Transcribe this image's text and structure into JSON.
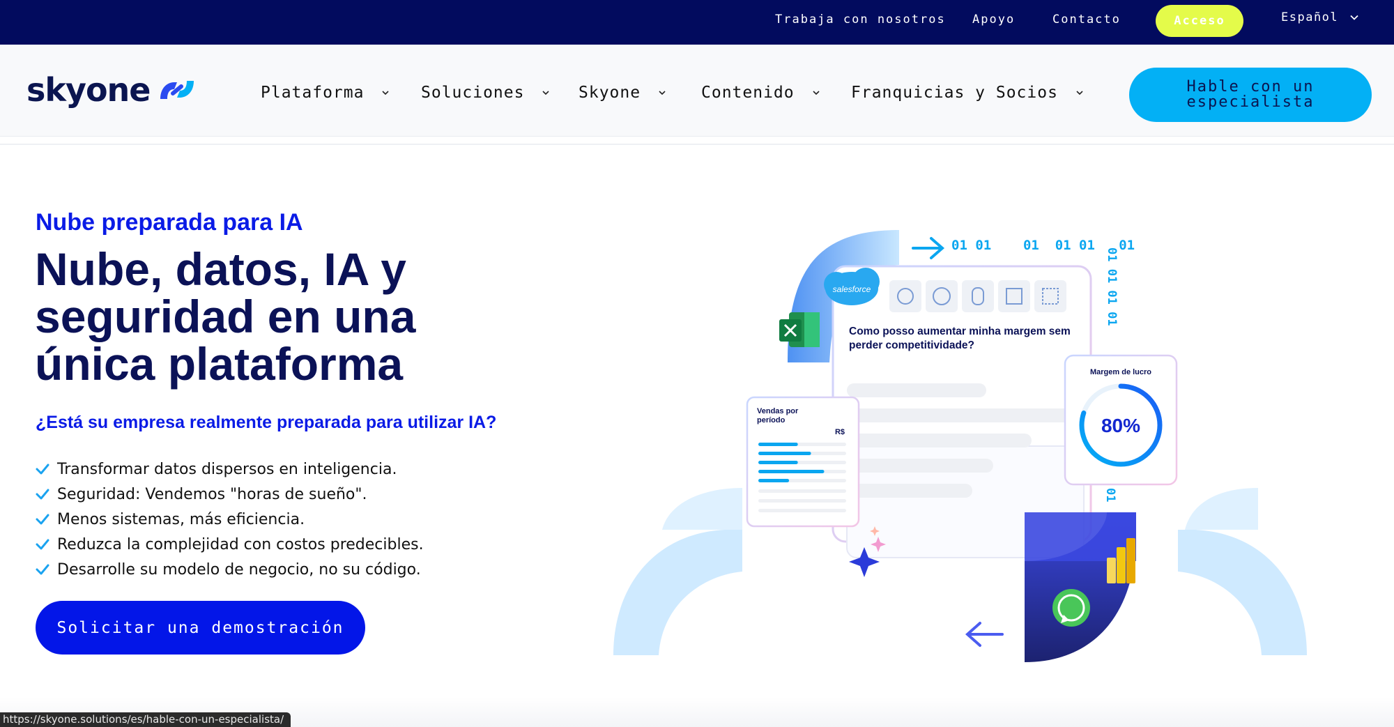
{
  "topbar": {
    "links": [
      "Trabaja con nosotros",
      "Apoyo",
      "Contacto"
    ],
    "login_label": "Acceso",
    "language": "Español",
    "background": "#020b5e",
    "login_color": "#e4fb4a"
  },
  "nav": {
    "logo_text": "skyone",
    "items": [
      "Plataforma",
      "Soluciones",
      "Skyone",
      "Contenido",
      "Franquicias y Socios"
    ],
    "cta_label": "Hable con un especialista",
    "cta_color": "#03b0f5"
  },
  "hero": {
    "eyebrow": "Nube preparada para IA",
    "headline": "Nube, datos, IA y seguridad en una única plataforma",
    "question": "¿Está su empresa realmente preparada para utilizar IA?",
    "bullets": [
      "Transformar datos dispersos en inteligencia.",
      "Seguridad: Vendemos \"horas de sueño\".",
      "Menos sistemas, más eficiencia.",
      "Reduzca la complejidad con costos predecibles.",
      "Desarrolle su modelo de negocio, no su código."
    ],
    "cta_label": "Solicitar una demostración",
    "accent": "#0a1be6"
  },
  "illustration": {
    "chat_question": "Como posso aumentar minha margem sem perder competitividade?",
    "sales_card_title": "Vendas por período",
    "sales_card_currency": "R$",
    "sales_bars": [
      0.45,
      0.6,
      0.45,
      0.75,
      0.35
    ],
    "margin_card_title": "Margem de lucro",
    "margin_value": "80%",
    "margin_fraction": 0.8,
    "binary_top": "01 01    01  01 01   01",
    "binary_side": "01 01 01 01",
    "binary_low": "01",
    "salesforce_label": "salesforce",
    "icons": [
      "excel-icon",
      "salesforce-icon",
      "whatsapp-icon",
      "powerbi-icon",
      "sparkle-icon"
    ]
  },
  "status_url": "https://skyone.solutions/es/hable-con-un-especialista/"
}
